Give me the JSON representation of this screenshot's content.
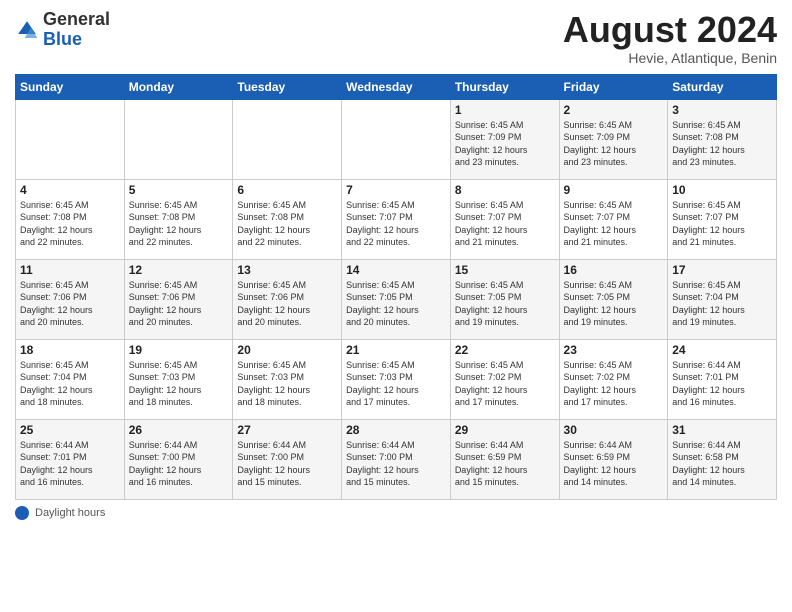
{
  "header": {
    "logo_general": "General",
    "logo_blue": "Blue",
    "main_title": "August 2024",
    "subtitle": "Hevie, Atlantique, Benin"
  },
  "calendar": {
    "days_of_week": [
      "Sunday",
      "Monday",
      "Tuesday",
      "Wednesday",
      "Thursday",
      "Friday",
      "Saturday"
    ],
    "weeks": [
      [
        {
          "day": "",
          "info": ""
        },
        {
          "day": "",
          "info": ""
        },
        {
          "day": "",
          "info": ""
        },
        {
          "day": "",
          "info": ""
        },
        {
          "day": "1",
          "info": "Sunrise: 6:45 AM\nSunset: 7:09 PM\nDaylight: 12 hours\nand 23 minutes."
        },
        {
          "day": "2",
          "info": "Sunrise: 6:45 AM\nSunset: 7:09 PM\nDaylight: 12 hours\nand 23 minutes."
        },
        {
          "day": "3",
          "info": "Sunrise: 6:45 AM\nSunset: 7:08 PM\nDaylight: 12 hours\nand 23 minutes."
        }
      ],
      [
        {
          "day": "4",
          "info": "Sunrise: 6:45 AM\nSunset: 7:08 PM\nDaylight: 12 hours\nand 22 minutes."
        },
        {
          "day": "5",
          "info": "Sunrise: 6:45 AM\nSunset: 7:08 PM\nDaylight: 12 hours\nand 22 minutes."
        },
        {
          "day": "6",
          "info": "Sunrise: 6:45 AM\nSunset: 7:08 PM\nDaylight: 12 hours\nand 22 minutes."
        },
        {
          "day": "7",
          "info": "Sunrise: 6:45 AM\nSunset: 7:07 PM\nDaylight: 12 hours\nand 22 minutes."
        },
        {
          "day": "8",
          "info": "Sunrise: 6:45 AM\nSunset: 7:07 PM\nDaylight: 12 hours\nand 21 minutes."
        },
        {
          "day": "9",
          "info": "Sunrise: 6:45 AM\nSunset: 7:07 PM\nDaylight: 12 hours\nand 21 minutes."
        },
        {
          "day": "10",
          "info": "Sunrise: 6:45 AM\nSunset: 7:07 PM\nDaylight: 12 hours\nand 21 minutes."
        }
      ],
      [
        {
          "day": "11",
          "info": "Sunrise: 6:45 AM\nSunset: 7:06 PM\nDaylight: 12 hours\nand 20 minutes."
        },
        {
          "day": "12",
          "info": "Sunrise: 6:45 AM\nSunset: 7:06 PM\nDaylight: 12 hours\nand 20 minutes."
        },
        {
          "day": "13",
          "info": "Sunrise: 6:45 AM\nSunset: 7:06 PM\nDaylight: 12 hours\nand 20 minutes."
        },
        {
          "day": "14",
          "info": "Sunrise: 6:45 AM\nSunset: 7:05 PM\nDaylight: 12 hours\nand 20 minutes."
        },
        {
          "day": "15",
          "info": "Sunrise: 6:45 AM\nSunset: 7:05 PM\nDaylight: 12 hours\nand 19 minutes."
        },
        {
          "day": "16",
          "info": "Sunrise: 6:45 AM\nSunset: 7:05 PM\nDaylight: 12 hours\nand 19 minutes."
        },
        {
          "day": "17",
          "info": "Sunrise: 6:45 AM\nSunset: 7:04 PM\nDaylight: 12 hours\nand 19 minutes."
        }
      ],
      [
        {
          "day": "18",
          "info": "Sunrise: 6:45 AM\nSunset: 7:04 PM\nDaylight: 12 hours\nand 18 minutes."
        },
        {
          "day": "19",
          "info": "Sunrise: 6:45 AM\nSunset: 7:03 PM\nDaylight: 12 hours\nand 18 minutes."
        },
        {
          "day": "20",
          "info": "Sunrise: 6:45 AM\nSunset: 7:03 PM\nDaylight: 12 hours\nand 18 minutes."
        },
        {
          "day": "21",
          "info": "Sunrise: 6:45 AM\nSunset: 7:03 PM\nDaylight: 12 hours\nand 17 minutes."
        },
        {
          "day": "22",
          "info": "Sunrise: 6:45 AM\nSunset: 7:02 PM\nDaylight: 12 hours\nand 17 minutes."
        },
        {
          "day": "23",
          "info": "Sunrise: 6:45 AM\nSunset: 7:02 PM\nDaylight: 12 hours\nand 17 minutes."
        },
        {
          "day": "24",
          "info": "Sunrise: 6:44 AM\nSunset: 7:01 PM\nDaylight: 12 hours\nand 16 minutes."
        }
      ],
      [
        {
          "day": "25",
          "info": "Sunrise: 6:44 AM\nSunset: 7:01 PM\nDaylight: 12 hours\nand 16 minutes."
        },
        {
          "day": "26",
          "info": "Sunrise: 6:44 AM\nSunset: 7:00 PM\nDaylight: 12 hours\nand 16 minutes."
        },
        {
          "day": "27",
          "info": "Sunrise: 6:44 AM\nSunset: 7:00 PM\nDaylight: 12 hours\nand 15 minutes."
        },
        {
          "day": "28",
          "info": "Sunrise: 6:44 AM\nSunset: 7:00 PM\nDaylight: 12 hours\nand 15 minutes."
        },
        {
          "day": "29",
          "info": "Sunrise: 6:44 AM\nSunset: 6:59 PM\nDaylight: 12 hours\nand 15 minutes."
        },
        {
          "day": "30",
          "info": "Sunrise: 6:44 AM\nSunset: 6:59 PM\nDaylight: 12 hours\nand 14 minutes."
        },
        {
          "day": "31",
          "info": "Sunrise: 6:44 AM\nSunset: 6:58 PM\nDaylight: 12 hours\nand 14 minutes."
        }
      ]
    ]
  },
  "footer": {
    "daylight_label": "Daylight hours"
  }
}
